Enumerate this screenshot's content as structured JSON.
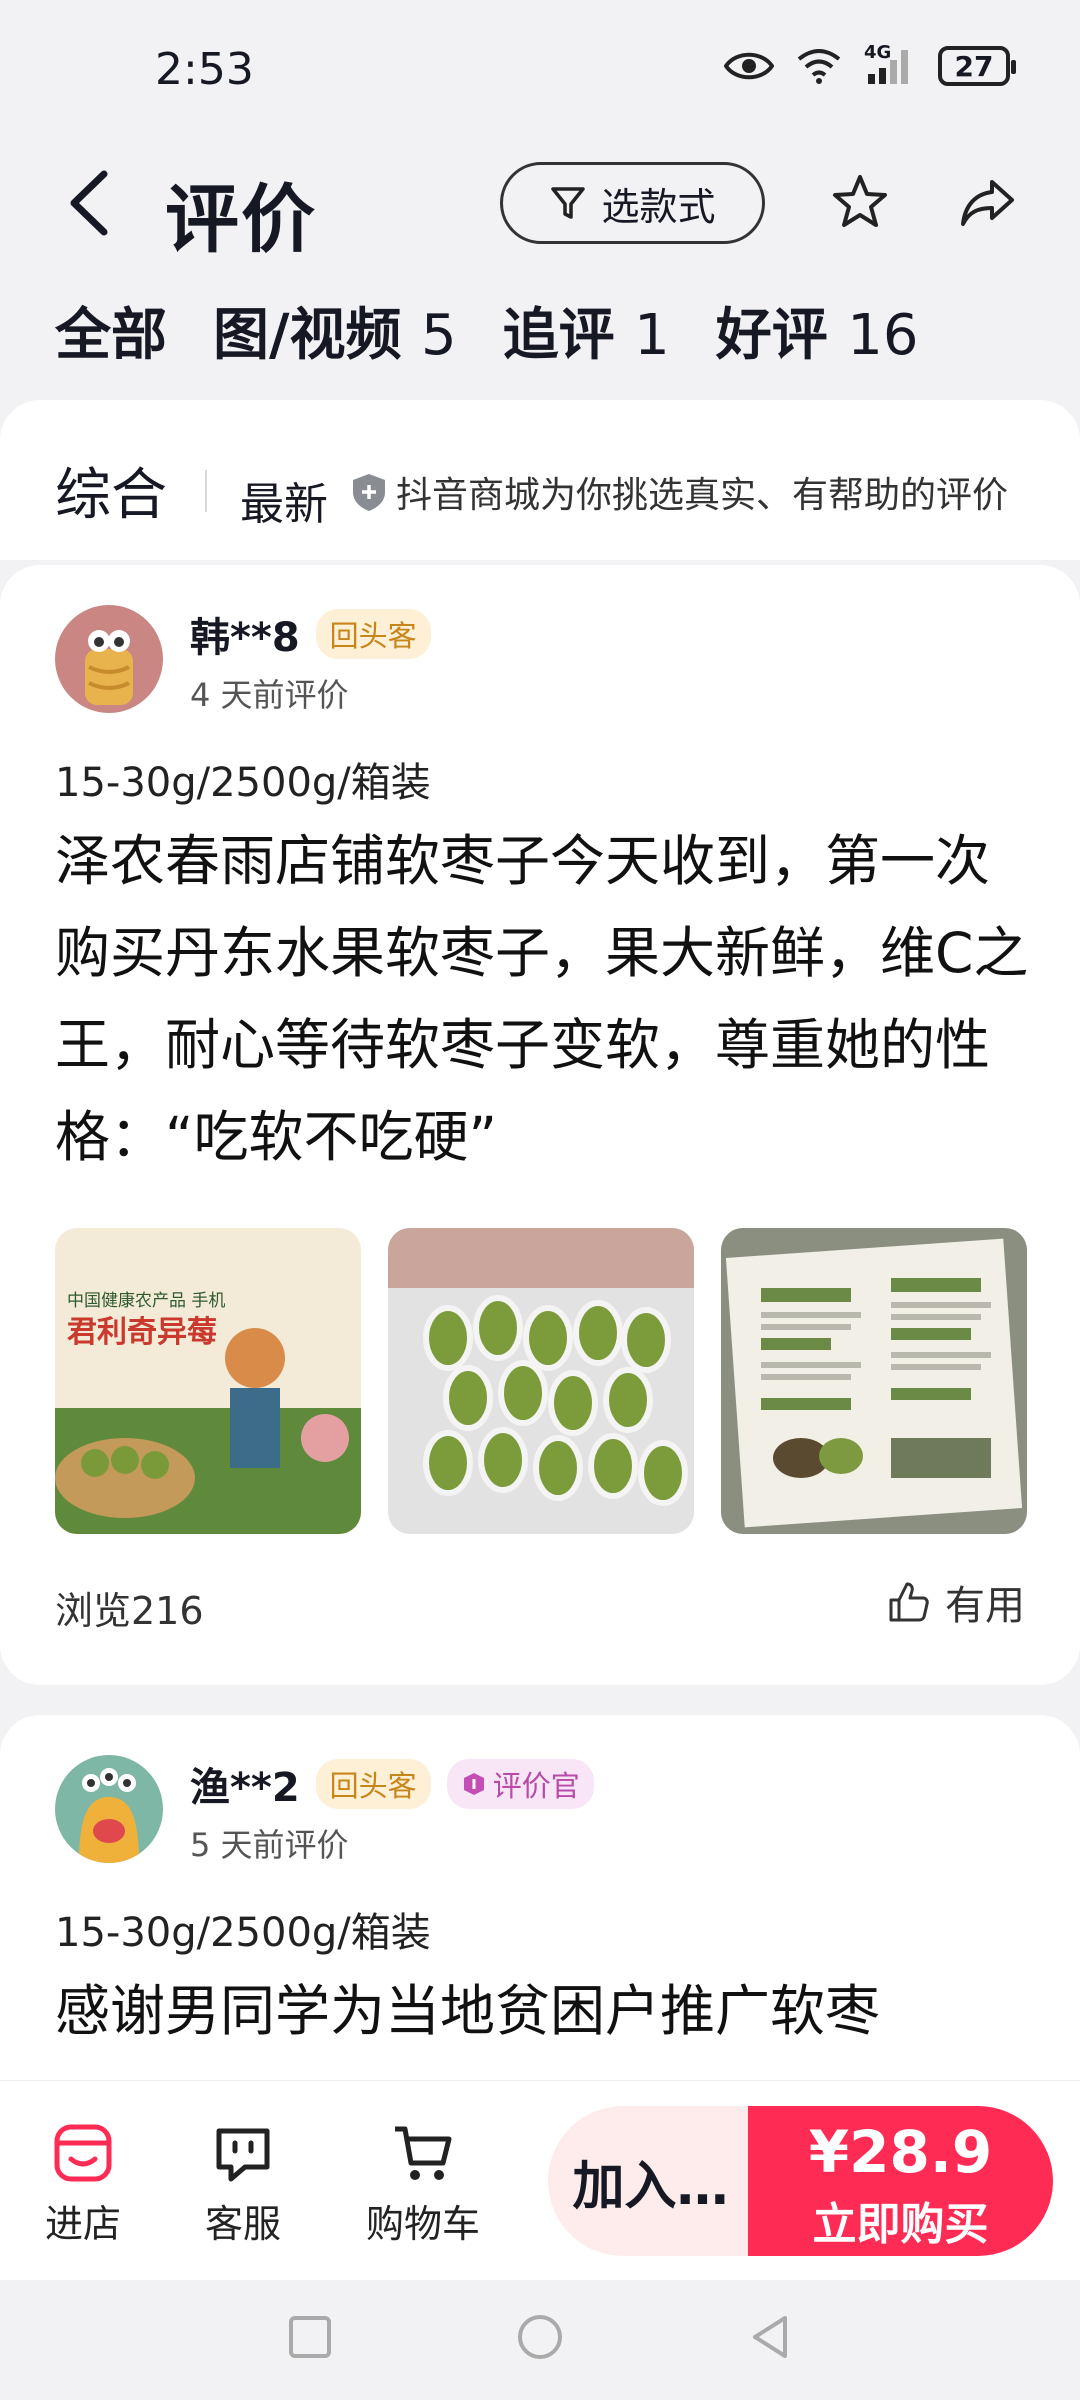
{
  "status": {
    "time": "2:53",
    "network": "4G",
    "battery": "27"
  },
  "header": {
    "title": "评价",
    "filter_label": "选款式"
  },
  "tabs": [
    {
      "label": "全部",
      "count": ""
    },
    {
      "label": "图/视频",
      "count": "5"
    },
    {
      "label": "追评",
      "count": "1"
    },
    {
      "label": "好评",
      "count": "16"
    }
  ],
  "sort": {
    "main": "综合",
    "newest": "最新",
    "note": "抖音商城为你挑选真实、有帮助的评价"
  },
  "reviews": [
    {
      "user": "韩**8",
      "badges": [
        "回头客"
      ],
      "time": "4 天前评价",
      "spec": "15-30g/2500g/箱装",
      "content": "泽农春雨店铺软枣子今天收到，第一次购买丹东水果软枣子，果大新鲜，维C之王，耐心等待软枣子变软，尊重她的性格：“吃软不吃硬”",
      "views": "浏览216",
      "useful": "有用",
      "photo_text": {
        "line1": "中国健康农产品 手机",
        "line2": "君利奇异莓"
      }
    },
    {
      "user": "渔**2",
      "badges": [
        "回头客",
        "评价官"
      ],
      "time": "5 天前评价",
      "spec": "15-30g/2500g/箱装",
      "content": "感谢男同学为当地贫困户推广软枣"
    }
  ],
  "bottom": {
    "store": "进店",
    "service": "客服",
    "cart": "购物车",
    "add_cart": "加入…",
    "price": "¥28.9",
    "buy": "立即购买"
  },
  "colors": {
    "accent": "#fe2c55",
    "background": "#f2f2f5"
  }
}
